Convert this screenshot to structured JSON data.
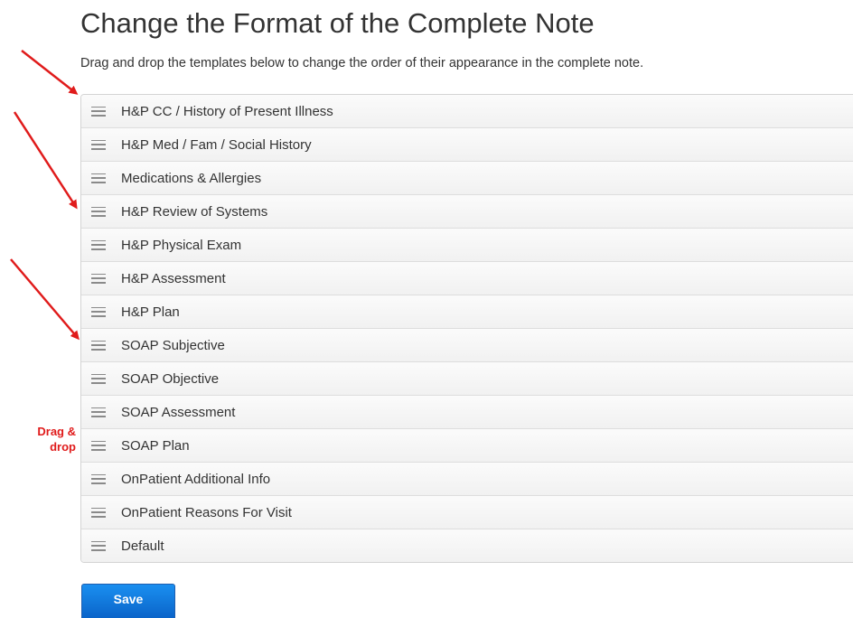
{
  "page": {
    "title": "Change the Format of the Complete Note",
    "instructions": "Drag and drop the templates below to change the order of their appearance in the complete note."
  },
  "templates": [
    {
      "label": "H&P CC / History of Present Illness"
    },
    {
      "label": "H&P Med / Fam / Social History"
    },
    {
      "label": "Medications & Allergies"
    },
    {
      "label": "H&P Review of Systems"
    },
    {
      "label": "H&P Physical Exam"
    },
    {
      "label": "H&P Assessment"
    },
    {
      "label": "H&P Plan"
    },
    {
      "label": "SOAP Subjective"
    },
    {
      "label": "SOAP Objective"
    },
    {
      "label": "SOAP Assessment"
    },
    {
      "label": "SOAP Plan"
    },
    {
      "label": "OnPatient Additional Info"
    },
    {
      "label": "OnPatient Reasons For Visit"
    },
    {
      "label": "Default"
    }
  ],
  "actions": {
    "save_label": "Save"
  },
  "annotation": {
    "line1": "Drag &",
    "line2": "drop",
    "color": "#e01b1b"
  },
  "icons": {
    "drag_handle": "hamburger-drag-icon",
    "annotation_arrow": "red-arrow-icon"
  }
}
